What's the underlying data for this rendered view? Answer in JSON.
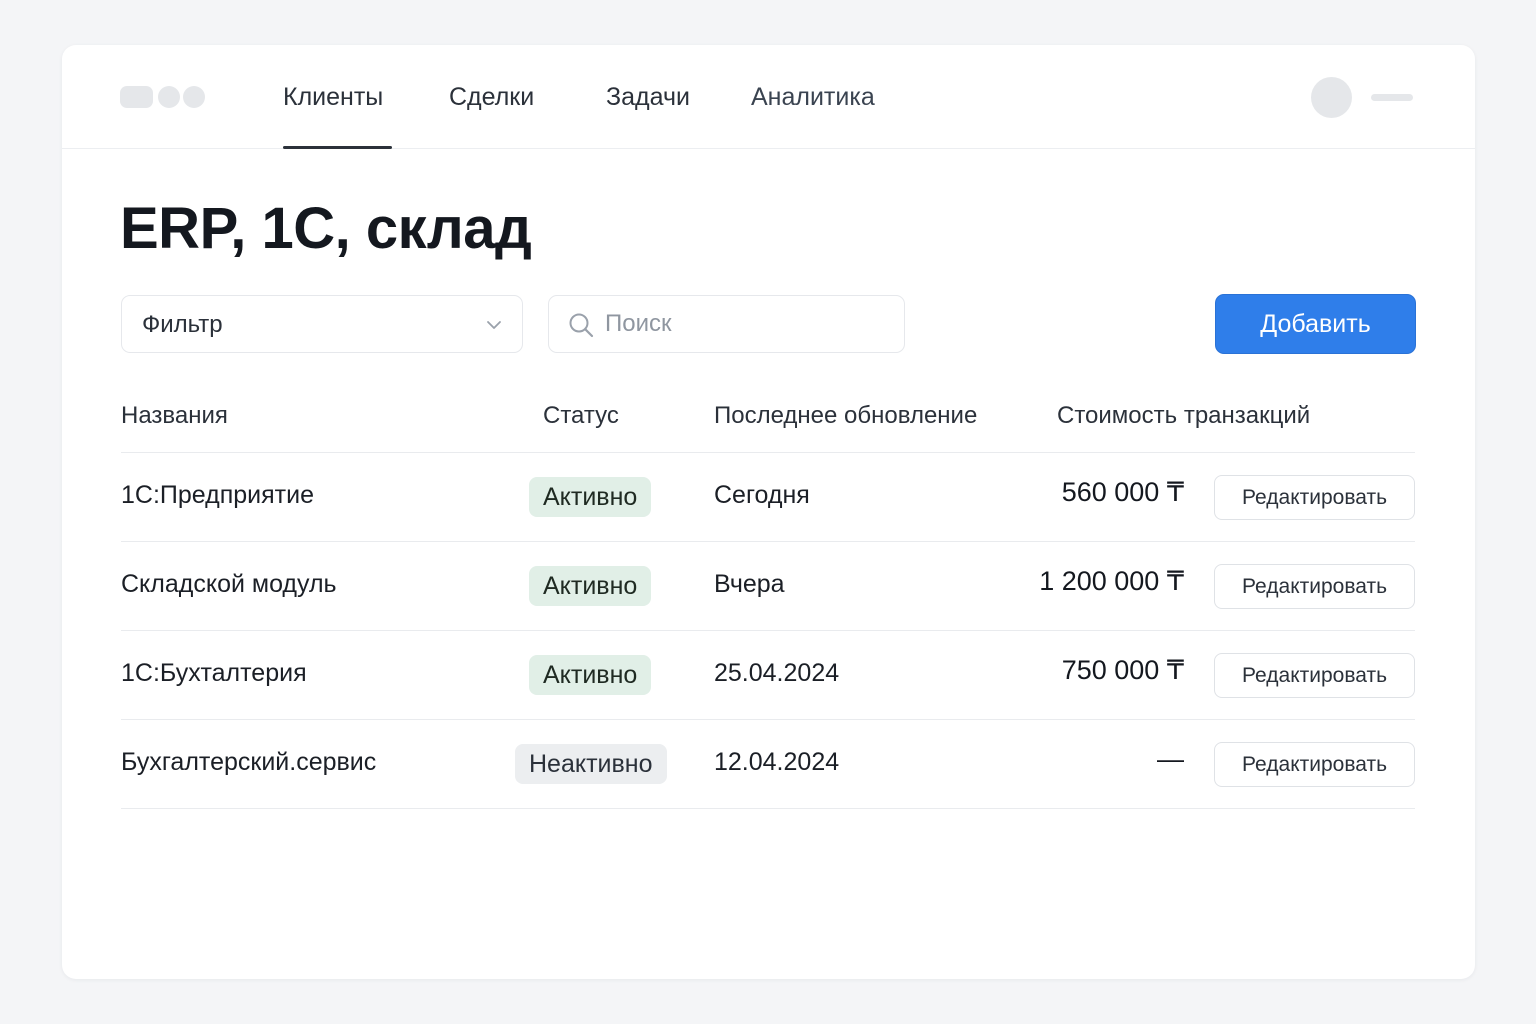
{
  "header": {
    "nav": [
      {
        "label": "Клиенты",
        "active": true
      },
      {
        "label": "Сделки",
        "active": false
      },
      {
        "label": "Задачи",
        "active": false
      },
      {
        "label": "Аналитика",
        "active": false
      }
    ]
  },
  "page": {
    "title": "ERP, 1С, склад"
  },
  "toolbar": {
    "filter_label": "Фильтр",
    "search_placeholder": "Поиск",
    "add_label": "Добавить"
  },
  "table": {
    "columns": [
      "Названия",
      "Статус",
      "Последнее обновление",
      "Стоимость транзакций"
    ],
    "rows": [
      {
        "name": "1С:Предприятие",
        "status": "Активно",
        "status_type": "active",
        "updated": "Сегодня",
        "amount": "560 000 ₸",
        "action": "Редактировать"
      },
      {
        "name": "Складской модуль",
        "status": "Активно",
        "status_type": "active",
        "updated": "Вчера",
        "amount": "1 200 000 ₸",
        "action": "Редактировать"
      },
      {
        "name": "1С:Бухталтерия",
        "status": "Активно",
        "status_type": "active",
        "updated": "25.04.2024",
        "amount": "750 000 ₸",
        "action": "Редактировать"
      },
      {
        "name": "Бухгалтерский.сервис",
        "status": "Неактивно",
        "status_type": "inactive",
        "updated": "12.04.2024",
        "amount": "—",
        "action": "Редактировать"
      }
    ]
  },
  "colors": {
    "accent": "#2f7eea",
    "badge_active_bg": "#e1efe7",
    "badge_inactive_bg": "#eceef0"
  },
  "icons": {
    "search": "search-icon",
    "filter_dropdown": "chevron-down-icon"
  }
}
